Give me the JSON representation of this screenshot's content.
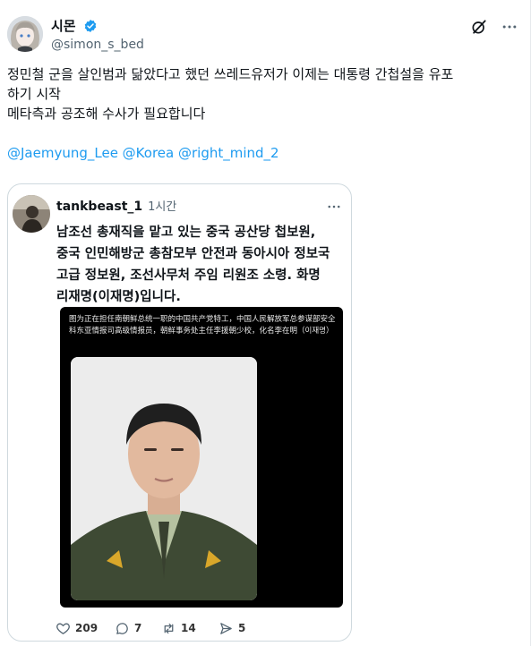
{
  "author": {
    "display_name": "시몬",
    "handle": "@simon_s_bed"
  },
  "tweet": {
    "line1": "정민철 군을 살인범과 닮았다고 했던 쓰레드유저가 이제는 대통령 간첩설을 유포",
    "line2": "하기 시작",
    "line3": "메타측과 공조해 수사가 필요합니다",
    "mentions": "@Jaemyung_Lee @Korea @right_mind_2"
  },
  "quote": {
    "handle": "tankbeast_1",
    "time": "1시간",
    "text_lines": [
      "남조선 총재직을 맡고 있는 중국 공산당 첩보원,",
      "중국 인민해방군 총참모부 안전과 동아시아 정보국",
      "고급 정보원, 조선사무처 주임 리원조 소령. 화명",
      "리재명(이재명)입니다."
    ],
    "image_caption": "图为正在担任南朝鲜总统一职的中国共产党特工，中国人民解放军总参谋部安全科东亚情报司高级情报员，朝鲜事务处主任李援朝少校，化名李在明（이재명）"
  },
  "stats": {
    "likes": "209",
    "replies": "7",
    "retweets": "14",
    "views": "5"
  },
  "icons": {
    "verified": "verified-badge-icon",
    "grok": "grok-icon",
    "more": "more-icon",
    "like": "heart-icon",
    "reply": "reply-icon",
    "retweet": "retweet-icon",
    "views": "send-icon"
  },
  "colors": {
    "accent": "#1d9bf0",
    "text": "#0f1419",
    "muted": "#536471",
    "border": "#cfd9de"
  }
}
